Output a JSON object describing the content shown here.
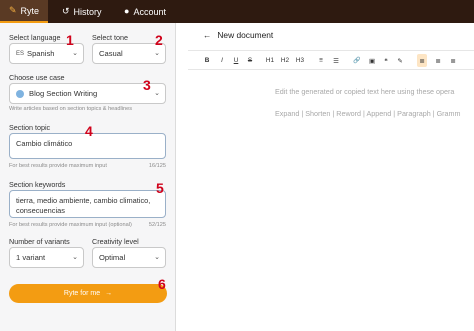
{
  "nav": {
    "tabs": [
      {
        "label": "Ryte",
        "icon": "pen-icon"
      },
      {
        "label": "History",
        "icon": "history-icon"
      },
      {
        "label": "Account",
        "icon": "user-icon"
      }
    ]
  },
  "form": {
    "language_label": "Select language",
    "language_value": "Spanish",
    "language_flag": "ES",
    "tone_label": "Select tone",
    "tone_value": "Casual",
    "usecase_label": "Choose use case",
    "usecase_value": "Blog Section Writing",
    "usecase_hint": "Write articles based on section topics & headlines",
    "topic_label": "Section topic",
    "topic_value": "Cambio climático",
    "topic_hint": "For best results provide maximum input",
    "topic_count": "16/125",
    "keywords_label": "Section keywords",
    "keywords_value": "tierra, medio ambiente, cambio climatico, consecuencias",
    "keywords_hint": "For best results provide maximum input (optional)",
    "keywords_count": "52/125",
    "variants_label": "Number of variants",
    "variants_value": "1 variant",
    "creativity_label": "Creativity level",
    "creativity_value": "Optimal",
    "submit_label": "Ryte for me",
    "submit_arrow": "→"
  },
  "annotations": [
    "1",
    "2",
    "3",
    "4",
    "5",
    "6"
  ],
  "editor": {
    "back_arrow": "←",
    "title": "New document",
    "toolbar": [
      "B",
      "I",
      "U",
      "S",
      "H1",
      "H2",
      "H3",
      "≡",
      "☰",
      "🔗",
      "▣",
      "❝",
      "✎",
      "≣",
      "≣",
      "≣"
    ],
    "placeholder": "Edit the generated or copied text here using these opera",
    "actions": "Expand | Shorten | Reword | Append | Paragraph | Gramm"
  },
  "colors": {
    "accent": "#f39c12",
    "topbar": "#2e1a10",
    "annotation": "#d0021b"
  }
}
